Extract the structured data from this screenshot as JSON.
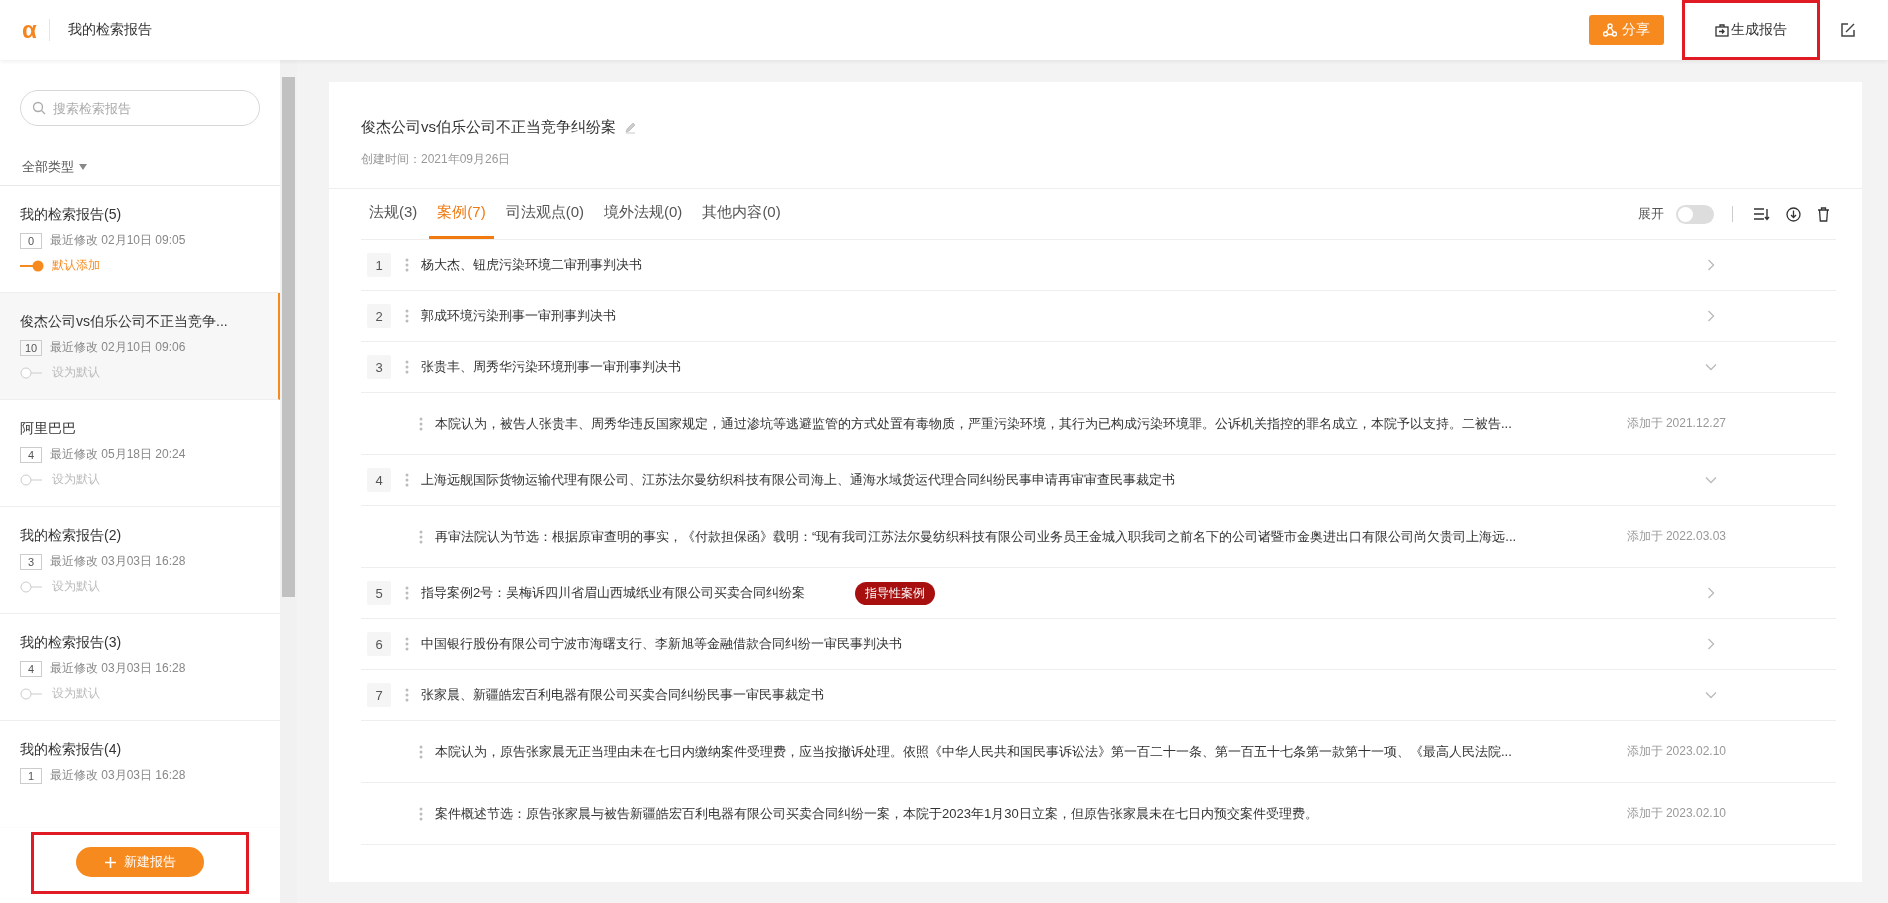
{
  "header": {
    "logo": "α",
    "title": "我的检索报告",
    "share_button": "分享",
    "generate_button": "生成报告"
  },
  "sidebar": {
    "search": {
      "placeholder": "搜索检索报告"
    },
    "filter": "全部类型",
    "items": [
      {
        "title": "我的检索报告(5)",
        "count": "0",
        "modified": "最近修改 02月10日 09:05",
        "default": true,
        "toggle_label": "默认添加",
        "selected": false
      },
      {
        "title": "俊杰公司vs伯乐公司不正当竞争...",
        "count": "10",
        "modified": "最近修改 02月10日 09:06",
        "default": false,
        "toggle_label": "设为默认",
        "selected": true
      },
      {
        "title": "阿里巴巴",
        "count": "4",
        "modified": "最近修改 05月18日 20:24",
        "default": false,
        "toggle_label": "设为默认",
        "selected": false
      },
      {
        "title": "我的检索报告(2)",
        "count": "3",
        "modified": "最近修改 03月03日 16:28",
        "default": false,
        "toggle_label": "设为默认",
        "selected": false
      },
      {
        "title": "我的检索报告(3)",
        "count": "4",
        "modified": "最近修改 03月03日 16:28",
        "default": false,
        "toggle_label": "设为默认",
        "selected": false
      },
      {
        "title": "我的检索报告(4)",
        "count": "1",
        "modified": "最近修改 03月03日 16:28",
        "selected": false
      }
    ],
    "new_button": "新建报告"
  },
  "report": {
    "title": "俊杰公司vs伯乐公司不正当竞争纠纷案",
    "created": "创建时间：2021年09月26日",
    "tabs": [
      {
        "label": "法规(3)",
        "selected": false
      },
      {
        "label": "案例(7)",
        "selected": true
      },
      {
        "label": "司法观点(0)",
        "selected": false
      },
      {
        "label": "境外法规(0)",
        "selected": false
      },
      {
        "label": "其他内容(0)",
        "selected": false
      }
    ],
    "expand_toggle": {
      "label": "展开",
      "on": false
    },
    "cases": [
      {
        "number": "1",
        "title": "杨大杰、钮虎污染环境二审刑事判决书",
        "expanded": false
      },
      {
        "number": "2",
        "title": "郭成环境污染刑事一审刑事判决书",
        "expanded": false
      },
      {
        "number": "3",
        "title": "张贵丰、周秀华污染环境刑事一审刑事判决书",
        "expanded": true,
        "excerpts": [
          {
            "text": "本院认为，被告人张贵丰、周秀华违反国家规定，通过渗坑等逃避监管的方式处置有毒物质，严重污染环境，其行为已构成污染环境罪。公诉机关指控的罪名成立，本院予以支持。二被告...",
            "date": "添加于 2021.12.27"
          }
        ]
      },
      {
        "number": "4",
        "title": "上海远舰国际货物运输代理有限公司、江苏法尔曼纺织科技有限公司海上、通海水域货运代理合同纠纷民事申请再审审查民事裁定书",
        "expanded": true,
        "excerpts": [
          {
            "text": "再审法院认为节选：根据原审查明的事实，《付款担保函》载明：“现有我司江苏法尔曼纺织科技有限公司业务员王金城入职我司之前名下的公司诸暨市金奥进出口有限公司尚欠贵司上海远...",
            "date": "添加于 2022.03.03"
          }
        ]
      },
      {
        "number": "5",
        "title": "指导案例2号：吴梅诉四川省眉山西城纸业有限公司买卖合同纠纷案",
        "badge": "指导性案例",
        "expanded": false
      },
      {
        "number": "6",
        "title": "中国银行股份有限公司宁波市海曙支行、李新旭等金融借款合同纠纷一审民事判决书",
        "expanded": false
      },
      {
        "number": "7",
        "title": "张家晨、新疆皓宏百利电器有限公司买卖合同纠纷民事一审民事裁定书",
        "expanded": true,
        "excerpts": [
          {
            "text": "本院认为，原告张家晨无正当理由未在七日内缴纳案件受理费，应当按撤诉处理。依照《中华人民共和国民事诉讼法》第一百二十一条、第一百五十七条第一款第十一项、《最高人民法院...",
            "date": "添加于 2023.02.10"
          },
          {
            "text": "案件概述节选：原告张家晨与被告新疆皓宏百利电器有限公司买卖合同纠纷一案，本院于2023年1月30日立案，但原告张家晨未在七日内预交案件受理费。",
            "date": "添加于 2023.02.10"
          }
        ]
      }
    ]
  }
}
